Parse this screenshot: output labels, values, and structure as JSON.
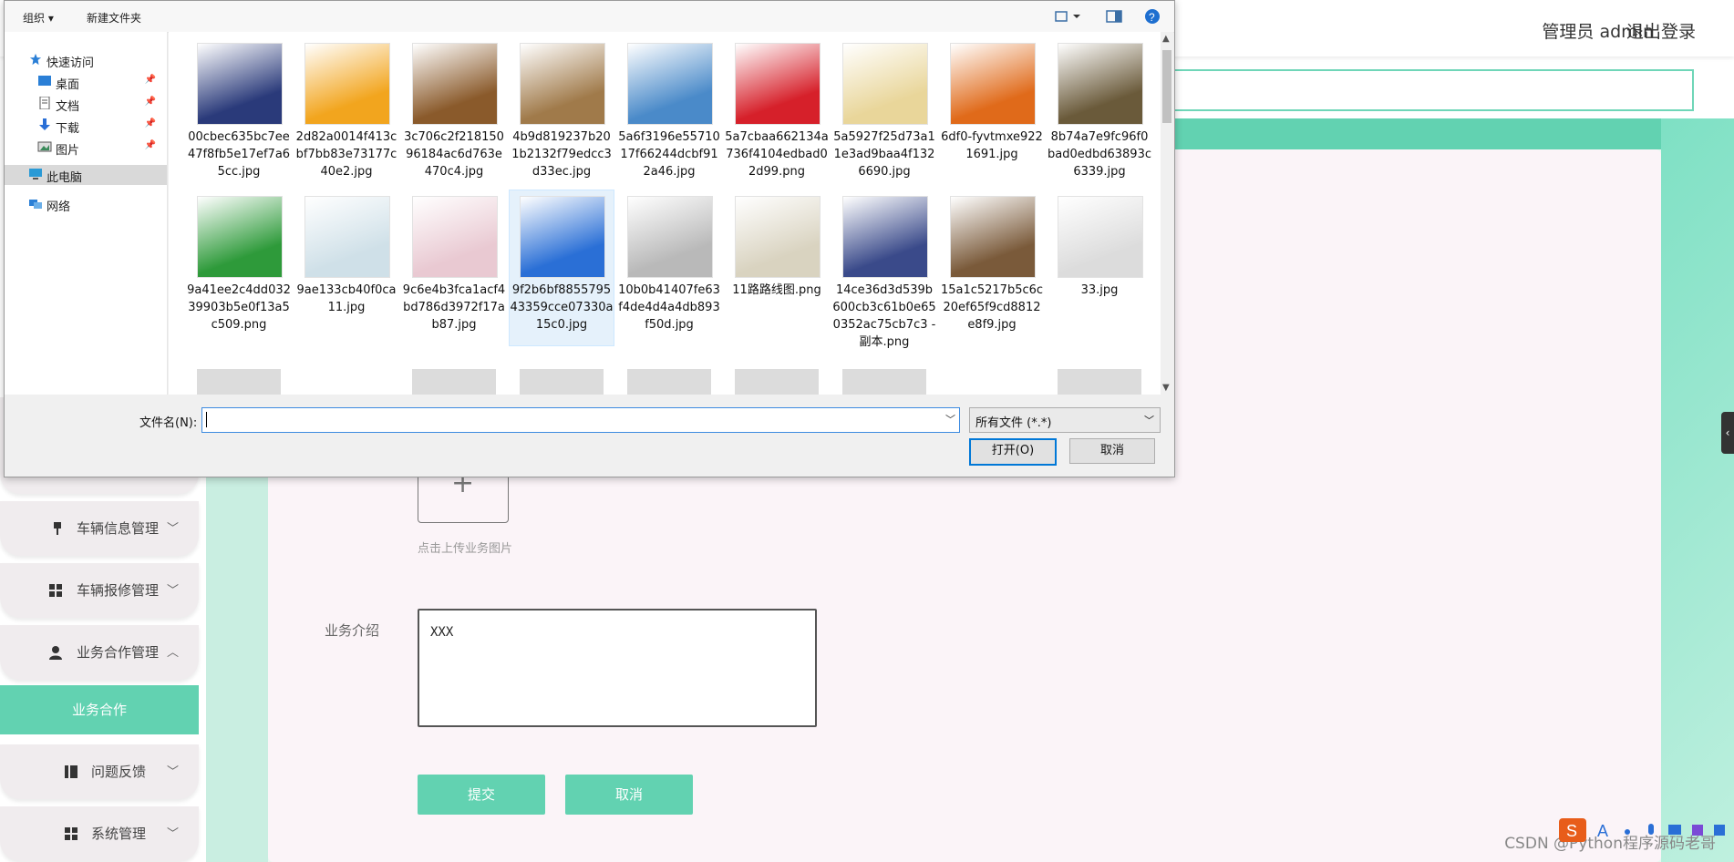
{
  "app": {
    "header": {
      "user": "管理员 admin",
      "logout": "退出登录"
    },
    "sidebar": {
      "items": [
        {
          "label": "车辆信息管理",
          "icon": "pin-icon",
          "chevron": "﹀"
        },
        {
          "label": "车辆报修管理",
          "icon": "grid-icon",
          "chevron": "﹀"
        },
        {
          "label": "业务合作管理",
          "icon": "user-icon",
          "chevron": "︿"
        },
        {
          "label": "问题反馈",
          "icon": "book-icon",
          "chevron": "﹀"
        },
        {
          "label": "系统管理",
          "icon": "grid-icon",
          "chevron": "﹀"
        }
      ],
      "active_item": "业务合作"
    },
    "form": {
      "upload_hint": "点击上传业务图片",
      "intro_label": "业务介绍",
      "intro_value": "XXX",
      "submit": "提交",
      "cancel": "取消"
    },
    "watermark": "CSDN @Python程序源码老哥"
  },
  "dialog": {
    "toolbar": {
      "organize": "组织 ▾",
      "new_folder": "新建文件夹"
    },
    "nav": [
      {
        "label": "快速访问",
        "icon": "star-icon"
      },
      {
        "label": "桌面",
        "icon": "desktop-icon",
        "pinned": true
      },
      {
        "label": "文档",
        "icon": "document-icon",
        "pinned": true
      },
      {
        "label": "下载",
        "icon": "download-icon",
        "pinned": true
      },
      {
        "label": "图片",
        "icon": "pictures-icon",
        "pinned": true
      },
      {
        "label": "此电脑",
        "icon": "computer-icon"
      },
      {
        "label": "网络",
        "icon": "network-icon"
      }
    ],
    "files": [
      {
        "name": "00cbec635bc7ee47f8fb5e17ef7a65cc.jpg",
        "thumb": "handbag",
        "color": "#2a3a7a"
      },
      {
        "name": "2d82a0014f413cbf7bb83e73177c40e2.jpg",
        "thumb": "abcd",
        "color": "#f2a51e"
      },
      {
        "name": "3c706c2f21815096184ac6d763e470c4.jpg",
        "thumb": "hotel-room",
        "color": "#8a5a2b"
      },
      {
        "name": "4b9d819237b201b2132f79edcc3d33ec.jpg",
        "thumb": "coins",
        "color": "#a07a4a"
      },
      {
        "name": "5a6f3196e5571017f66244dcbf912a46.jpg",
        "thumb": "building",
        "color": "#4a8ac9"
      },
      {
        "name": "5a7cbaa662134a736f4104edbad02d99.png",
        "thumb": "red-banner",
        "color": "#d6202a"
      },
      {
        "name": "5a5927f25d73a11e3ad9baa4f1326690.jpg",
        "thumb": "food",
        "color": "#e9d69a"
      },
      {
        "name": "6df0-fyvtmxe9221691.jpg",
        "thumb": "shoe",
        "color": "#e06a1a"
      },
      {
        "name": "8b74a7e9fc96f0bad0edbd63893c6339.jpg",
        "thumb": "poster",
        "color": "#6a5a3a"
      },
      {
        "name": "9a41ee2c4dd03239903b5e0f13a5c509.png",
        "thumb": "medicine-box",
        "color": "#2e9a3a"
      },
      {
        "name": "9ae133cb40f0ca11.jpg",
        "thumb": "coat",
        "color": "#cfe0e8"
      },
      {
        "name": "9c6e4b3fca1acf4bd786d3972f17ab87.jpg",
        "thumb": "cosmetics",
        "color": "#e9c9d2"
      },
      {
        "name": "9f2b6bf885579543359cce07330a15c0.jpg",
        "thumb": "water-bottle",
        "color": "#2a6fd6",
        "selected": true
      },
      {
        "name": "10b0b41407fe63f4de4d4a4db893f50d.jpg",
        "thumb": "wedding",
        "color": "#b9b9b9"
      },
      {
        "name": "11路路线图.png",
        "thumb": "map",
        "color": "#d9d3c0"
      },
      {
        "name": "14ce36d3d539b600cb3c61b0e650352ac75cb7c3 - 副本.png",
        "thumb": "phones",
        "color": "#3a4a8a"
      },
      {
        "name": "15a1c5217b5c6c20ef65f9cd8812e8f9.jpg",
        "thumb": "classroom",
        "color": "#7a5a3a"
      },
      {
        "name": "33.jpg",
        "thumb": "lab",
        "color": "#dcdcdc"
      }
    ],
    "filename_label": "文件名(N):",
    "filename_value": "",
    "filetype": "所有文件 (*.*)",
    "open": "打开(O)",
    "cancel": "取消"
  }
}
